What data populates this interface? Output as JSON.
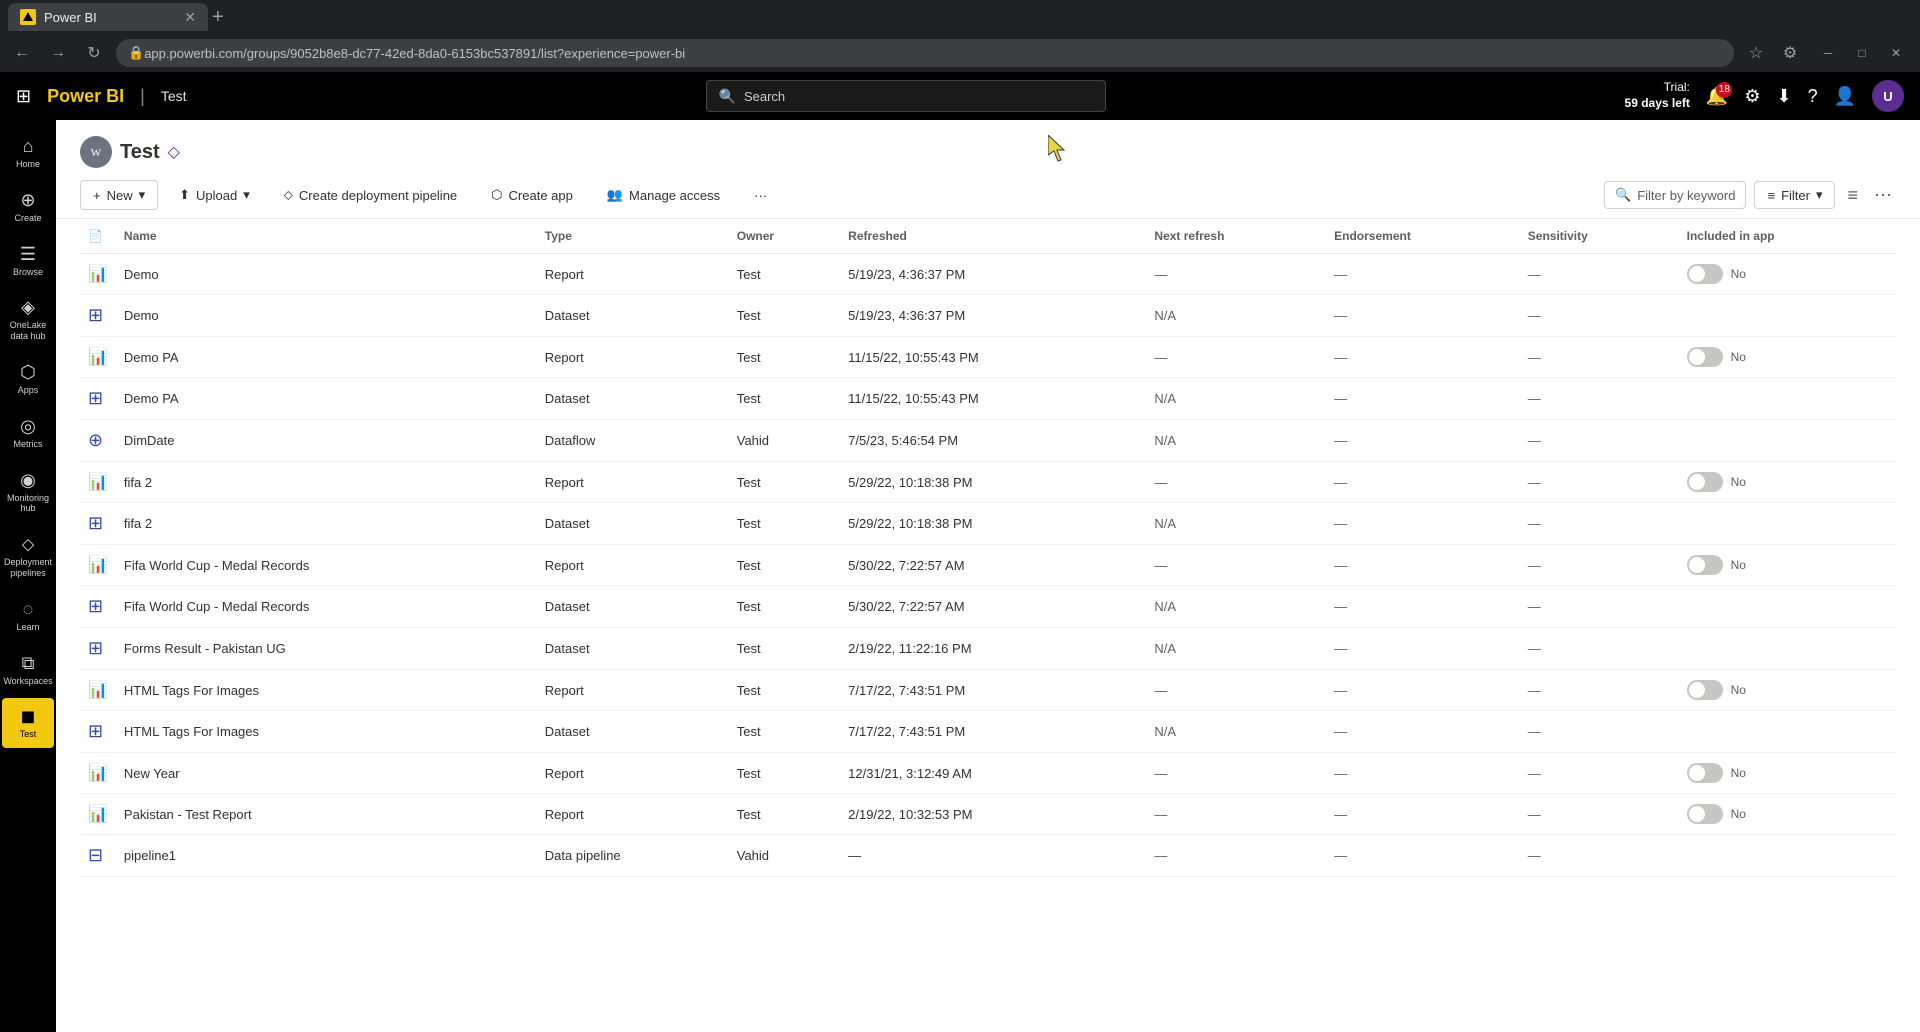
{
  "browser": {
    "tab_title": "Power BI",
    "tab_favicon": "PBI",
    "url": "app.powerbi.com/groups/9052b8e8-dc77-42ed-8da0-6153bc537891/list?experience=power-bi",
    "new_tab_btn": "+",
    "nav_back": "←",
    "nav_forward": "→",
    "nav_refresh": "↻",
    "win_minimize": "─",
    "win_maximize": "□",
    "win_close": "✕"
  },
  "topnav": {
    "waffle": "⊞",
    "app_name": "Power BI",
    "workspace_name": "Test",
    "search_placeholder": "Search",
    "trial_line1": "Trial:",
    "trial_line2": "59 days left",
    "notification_count": "18",
    "avatar_initials": "U"
  },
  "sidebar": {
    "items": [
      {
        "id": "home",
        "icon": "⌂",
        "label": "Home"
      },
      {
        "id": "create",
        "icon": "+",
        "label": "Create"
      },
      {
        "id": "browse",
        "icon": "☰",
        "label": "Browse"
      },
      {
        "id": "onelake",
        "icon": "◈",
        "label": "OneLake data hub"
      },
      {
        "id": "apps",
        "icon": "⬡",
        "label": "Apps"
      },
      {
        "id": "metrics",
        "icon": "◎",
        "label": "Metrics"
      },
      {
        "id": "monitoring",
        "icon": "◉",
        "label": "Monitoring hub"
      },
      {
        "id": "deployment",
        "icon": "⬦",
        "label": "Deployment pipelines"
      },
      {
        "id": "learn",
        "icon": "◌",
        "label": "Learn"
      },
      {
        "id": "workspaces",
        "icon": "⧉",
        "label": "Workspaces"
      },
      {
        "id": "test",
        "icon": "◼",
        "label": "Test",
        "active": true
      }
    ]
  },
  "workspace": {
    "icon": "W",
    "title": "Test",
    "diamond": "◇"
  },
  "toolbar": {
    "new_label": "New",
    "new_dropdown": "▾",
    "upload_label": "Upload",
    "upload_dropdown": "▾",
    "deployment_label": "Create deployment pipeline",
    "app_label": "Create app",
    "access_label": "Manage access",
    "more": "···",
    "filter_placeholder": "Filter by keyword",
    "filter_label": "Filter",
    "filter_dropdown": "▾",
    "view_list": "≡",
    "view_share": "⋯"
  },
  "table": {
    "columns": [
      "",
      "Name",
      "Type",
      "Owner",
      "Refreshed",
      "Next refresh",
      "Endorsement",
      "Sensitivity",
      "Included in app"
    ],
    "rows": [
      {
        "icon": "report",
        "icon_char": "📊",
        "name": "Demo",
        "type": "Report",
        "owner": "Test",
        "refreshed": "5/19/23, 4:36:37 PM",
        "next_refresh": "—",
        "endorsement": "—",
        "sensitivity": "—",
        "included": true
      },
      {
        "icon": "dataset",
        "icon_char": "⊞",
        "name": "Demo",
        "type": "Dataset",
        "owner": "Test",
        "refreshed": "5/19/23, 4:36:37 PM",
        "next_refresh": "N/A",
        "endorsement": "—",
        "sensitivity": "—",
        "included": false
      },
      {
        "icon": "report",
        "icon_char": "📊",
        "name": "Demo PA",
        "type": "Report",
        "owner": "Test",
        "refreshed": "11/15/22, 10:55:43 PM",
        "next_refresh": "—",
        "endorsement": "—",
        "sensitivity": "—",
        "included": true
      },
      {
        "icon": "dataset",
        "icon_char": "⊞",
        "name": "Demo PA",
        "type": "Dataset",
        "owner": "Test",
        "refreshed": "11/15/22, 10:55:43 PM",
        "next_refresh": "N/A",
        "endorsement": "—",
        "sensitivity": "—",
        "included": false
      },
      {
        "icon": "dataflow",
        "icon_char": "⊕",
        "name": "DimDate",
        "type": "Dataflow",
        "owner": "Vahid",
        "refreshed": "7/5/23, 5:46:54 PM",
        "next_refresh": "N/A",
        "endorsement": "—",
        "sensitivity": "—",
        "included": false
      },
      {
        "icon": "report",
        "icon_char": "📊",
        "name": "fifa 2",
        "type": "Report",
        "owner": "Test",
        "refreshed": "5/29/22, 10:18:38 PM",
        "next_refresh": "—",
        "endorsement": "—",
        "sensitivity": "—",
        "included": true
      },
      {
        "icon": "dataset",
        "icon_char": "⊞",
        "name": "fifa 2",
        "type": "Dataset",
        "owner": "Test",
        "refreshed": "5/29/22, 10:18:38 PM",
        "next_refresh": "N/A",
        "endorsement": "—",
        "sensitivity": "—",
        "included": false
      },
      {
        "icon": "report",
        "icon_char": "📊",
        "name": "Fifa World Cup - Medal Records",
        "type": "Report",
        "owner": "Test",
        "refreshed": "5/30/22, 7:22:57 AM",
        "next_refresh": "—",
        "endorsement": "—",
        "sensitivity": "—",
        "included": true
      },
      {
        "icon": "dataset",
        "icon_char": "⊞",
        "name": "Fifa World Cup - Medal Records",
        "type": "Dataset",
        "owner": "Test",
        "refreshed": "5/30/22, 7:22:57 AM",
        "next_refresh": "N/A",
        "endorsement": "—",
        "sensitivity": "—",
        "included": false
      },
      {
        "icon": "dataset",
        "icon_char": "⊞",
        "name": "Forms Result - Pakistan UG",
        "type": "Dataset",
        "owner": "Test",
        "refreshed": "2/19/22, 11:22:16 PM",
        "next_refresh": "N/A",
        "endorsement": "—",
        "sensitivity": "—",
        "included": false
      },
      {
        "icon": "report",
        "icon_char": "📊",
        "name": "HTML Tags For Images",
        "type": "Report",
        "owner": "Test",
        "refreshed": "7/17/22, 7:43:51 PM",
        "next_refresh": "—",
        "endorsement": "—",
        "sensitivity": "—",
        "included": true
      },
      {
        "icon": "dataset",
        "icon_char": "⊞",
        "name": "HTML Tags For Images",
        "type": "Dataset",
        "owner": "Test",
        "refreshed": "7/17/22, 7:43:51 PM",
        "next_refresh": "N/A",
        "endorsement": "—",
        "sensitivity": "—",
        "included": false
      },
      {
        "icon": "report",
        "icon_char": "📊",
        "name": "New Year",
        "type": "Report",
        "owner": "Test",
        "refreshed": "12/31/21, 3:12:49 AM",
        "next_refresh": "—",
        "endorsement": "—",
        "sensitivity": "—",
        "included": true
      },
      {
        "icon": "report",
        "icon_char": "📊",
        "name": "Pakistan - Test Report",
        "type": "Report",
        "owner": "Test",
        "refreshed": "2/19/22, 10:32:53 PM",
        "next_refresh": "—",
        "endorsement": "—",
        "sensitivity": "—",
        "included": true
      },
      {
        "icon": "pipeline",
        "icon_char": "⊟",
        "name": "pipeline1",
        "type": "Data pipeline",
        "owner": "Vahid",
        "refreshed": "—",
        "next_refresh": "—",
        "endorsement": "—",
        "sensitivity": "—",
        "included": false
      }
    ]
  }
}
